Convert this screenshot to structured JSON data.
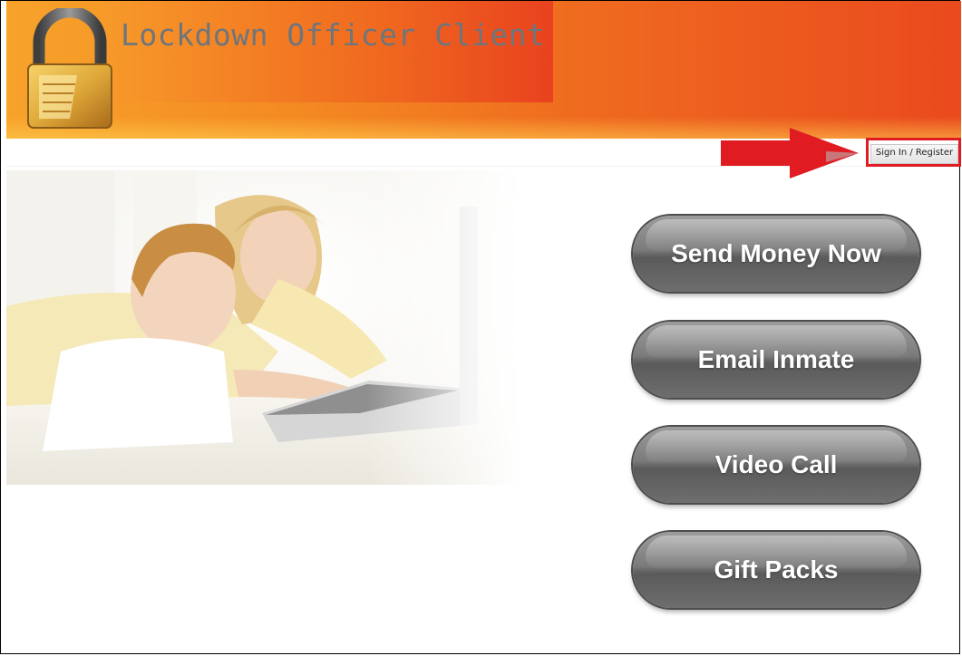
{
  "header": {
    "app_title": "Lockdown Officer Client",
    "logo_icon": "padlock-icon",
    "colors": {
      "orange_light": "#f7a22b",
      "orange_dark": "#ea4a1e",
      "title_text": "#6e757c"
    }
  },
  "toolbar": {
    "sign_in_label": "Sign In / Register",
    "pointer_icon": "red-arrow-icon",
    "highlight_color": "#e01b22"
  },
  "hero": {
    "image": "mother-and-child-at-laptop-photo"
  },
  "actions": {
    "send_money": "Send Money Now",
    "email_inmate": "Email Inmate",
    "video_call": "Video Call",
    "gift_packs": "Gift Packs",
    "button_color": "#7b7b7b"
  }
}
